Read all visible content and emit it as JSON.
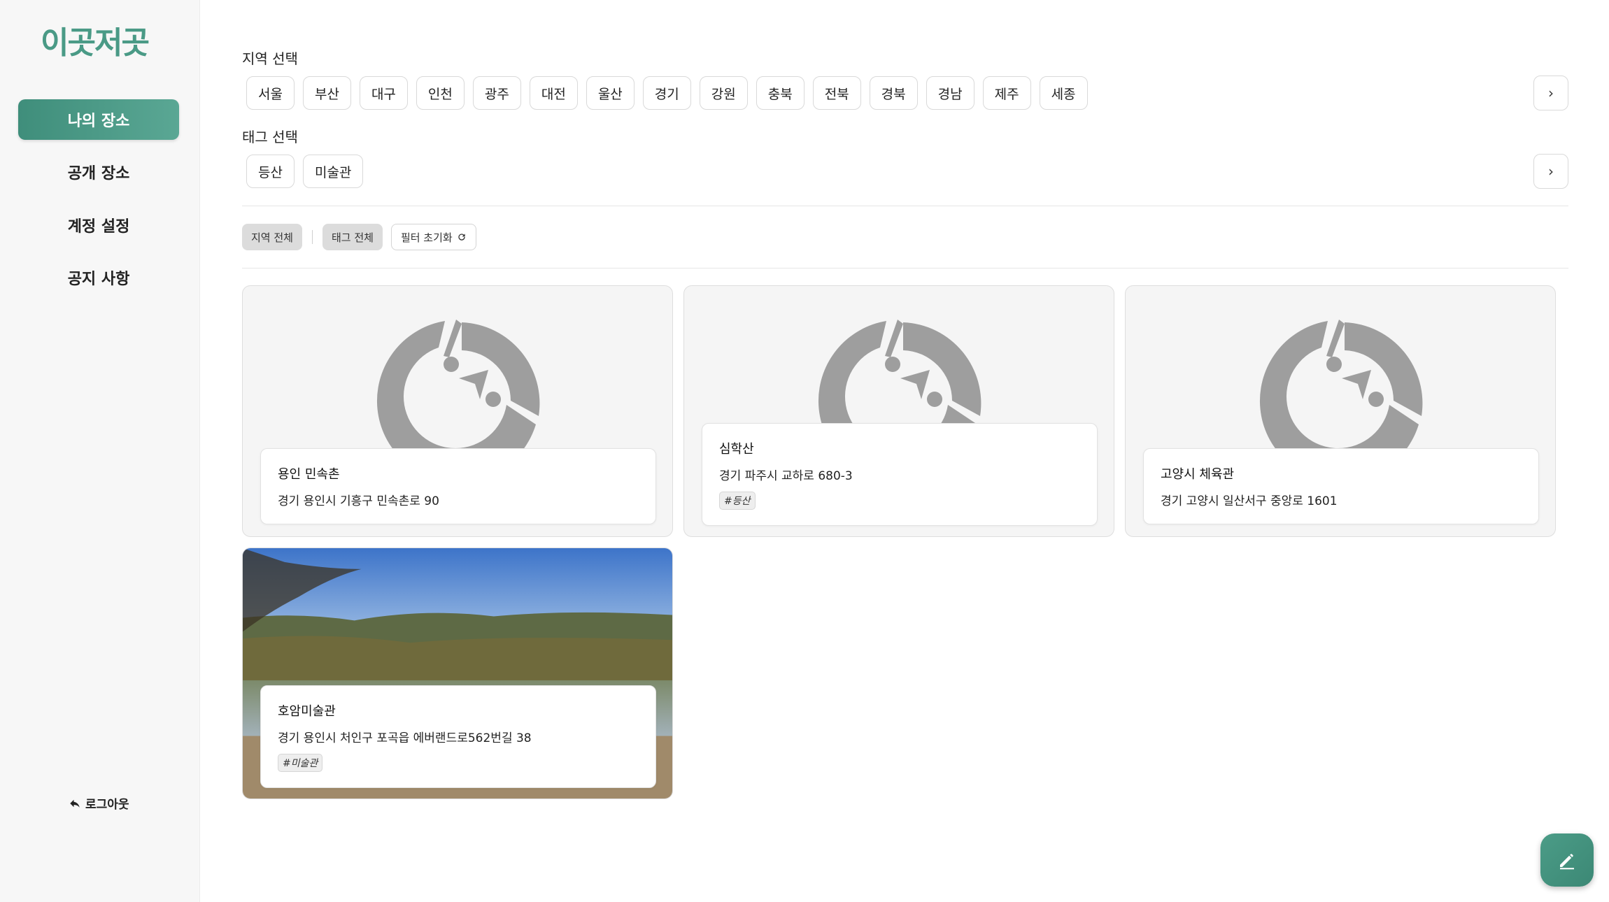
{
  "app": {
    "logo_text": "이곳저곳"
  },
  "sidebar": {
    "items": [
      {
        "label": "나의 장소",
        "active": true
      },
      {
        "label": "공개 장소",
        "active": false
      },
      {
        "label": "계정 설정",
        "active": false
      },
      {
        "label": "공지 사항",
        "active": false
      }
    ],
    "logout_label": "로그아웃"
  },
  "filters": {
    "region_title": "지역 선택",
    "regions": [
      "서울",
      "부산",
      "대구",
      "인천",
      "광주",
      "대전",
      "울산",
      "경기",
      "강원",
      "충북",
      "전북",
      "경북",
      "경남",
      "제주",
      "세종"
    ],
    "tag_title": "태그 선택",
    "tags": [
      "등산",
      "미술관"
    ],
    "next_icon": "chevron-right-icon",
    "region_all_label": "지역 전체",
    "tag_all_label": "태그 전체",
    "reset_label": "필터 초기화"
  },
  "places": [
    {
      "title": "용인 민속촌",
      "address": "경기 용인시 기흥구 민속촌로 90",
      "tag": "",
      "image": "placeholder"
    },
    {
      "title": "심학산",
      "address": "경기 파주시 교하로 680-3",
      "tag": "#등산",
      "image": "placeholder"
    },
    {
      "title": "고양시 체육관",
      "address": "경기 고양시 일산서구 중앙로 1601",
      "tag": "",
      "image": "placeholder"
    },
    {
      "title": "호암미술관",
      "address": "경기 용인시 처인구 포곡읍 에버랜드로562번길 38",
      "tag": "#미술관",
      "image": "photo"
    }
  ],
  "colors": {
    "accent": "#4a9a86",
    "placeholder_icon": "#9e9e9e"
  },
  "fab": {
    "icon": "pencil-icon"
  }
}
